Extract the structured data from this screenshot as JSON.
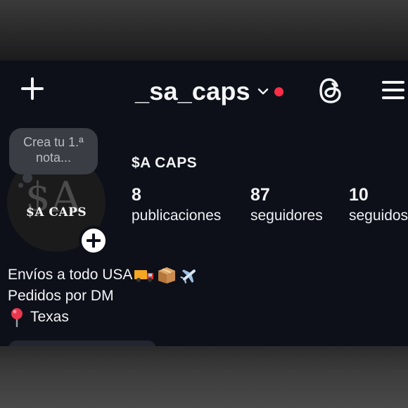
{
  "header": {
    "username": "_sa_caps",
    "has_notification_dot": true,
    "icons": [
      "plus-icon",
      "chevron-down-icon",
      "threads-icon",
      "menu-icon"
    ]
  },
  "note": {
    "text": "Crea tu 1.ª nota..."
  },
  "profile": {
    "avatar_text": "$A CAPS",
    "display_name": "$A CAPS",
    "stats": [
      {
        "value": "8",
        "label": "publicaciones"
      },
      {
        "value": "87",
        "label": "seguidores"
      },
      {
        "value": "10",
        "label": "seguidos"
      }
    ]
  },
  "bio": {
    "line1": "Envíos a todo USA",
    "line1_emojis": [
      "delivery-truck-icon",
      "package-icon",
      "airplane-icon"
    ],
    "line2": "Pedidos por DM",
    "line3": "Texas",
    "line3_icon": "round-pushpin-icon"
  },
  "colors": {
    "background": "#0d1019",
    "text": "#f2f3f5",
    "notification_dot": "#ff2d46",
    "note_bubble": "#3a3d44"
  }
}
